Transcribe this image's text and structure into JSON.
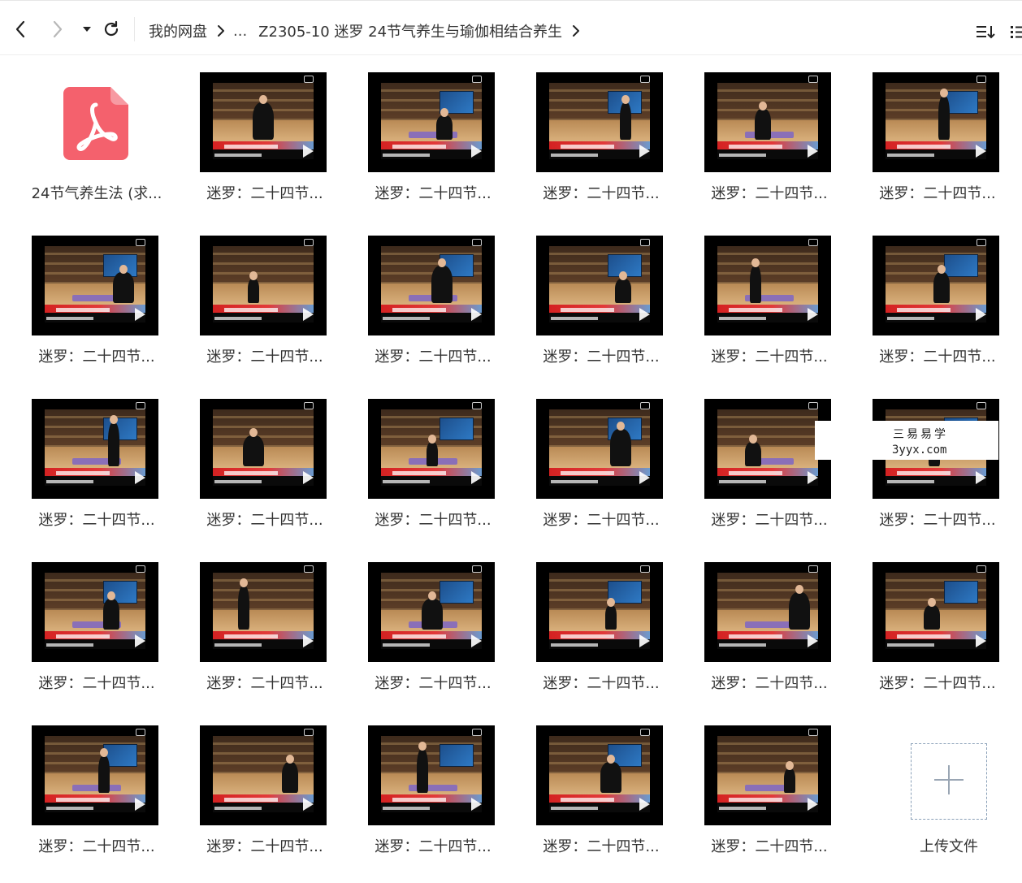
{
  "toolbar": {
    "back_icon": "chevron-left-icon",
    "forward_icon": "chevron-right-icon",
    "dropdown_icon": "caret-down-icon",
    "refresh_icon": "refresh-icon",
    "sort_icon": "sort-icon",
    "view_icon": "list-view-icon"
  },
  "breadcrumb": {
    "root": "我的网盘",
    "ellipsis": "...",
    "current": "Z2305-10 迷罗 24节气养生与瑜伽相结合养生"
  },
  "files": [
    {
      "type": "pdf",
      "label": "24节气养生法 (求..."
    },
    {
      "type": "video",
      "label": "迷罗：二十四节..."
    },
    {
      "type": "video",
      "label": "迷罗：二十四节..."
    },
    {
      "type": "video",
      "label": "迷罗：二十四节..."
    },
    {
      "type": "video",
      "label": "迷罗：二十四节..."
    },
    {
      "type": "video",
      "label": "迷罗：二十四节..."
    },
    {
      "type": "video",
      "label": "迷罗：二十四节..."
    },
    {
      "type": "video",
      "label": "迷罗：二十四节..."
    },
    {
      "type": "video",
      "label": "迷罗：二十四节..."
    },
    {
      "type": "video",
      "label": "迷罗：二十四节..."
    },
    {
      "type": "video",
      "label": "迷罗：二十四节..."
    },
    {
      "type": "video",
      "label": "迷罗：二十四节..."
    },
    {
      "type": "video",
      "label": "迷罗：二十四节..."
    },
    {
      "type": "video",
      "label": "迷罗：二十四节..."
    },
    {
      "type": "video",
      "label": "迷罗：二十四节..."
    },
    {
      "type": "video",
      "label": "迷罗：二十四节..."
    },
    {
      "type": "video",
      "label": "迷罗：二十四节..."
    },
    {
      "type": "video",
      "label": "迷罗：二十四节..."
    },
    {
      "type": "video",
      "label": "迷罗：二十四节..."
    },
    {
      "type": "video",
      "label": "迷罗：二十四节..."
    },
    {
      "type": "video",
      "label": "迷罗：二十四节..."
    },
    {
      "type": "video",
      "label": "迷罗：二十四节..."
    },
    {
      "type": "video",
      "label": "迷罗：二十四节..."
    },
    {
      "type": "video",
      "label": "迷罗：二十四节..."
    },
    {
      "type": "video",
      "label": "迷罗：二十四节..."
    },
    {
      "type": "video",
      "label": "迷罗：二十四节..."
    },
    {
      "type": "video",
      "label": "迷罗：二十四节..."
    },
    {
      "type": "video",
      "label": "迷罗：二十四节..."
    },
    {
      "type": "video",
      "label": "迷罗：二十四节..."
    }
  ],
  "upload": {
    "label": "上传文件",
    "icon": "plus-icon"
  },
  "watermark": {
    "line1": "三易易学",
    "line2": "3yyx.com"
  },
  "colors": {
    "pdf_accent": "#f4616d",
    "text": "#333333",
    "upload_border": "#8aa0b8"
  }
}
